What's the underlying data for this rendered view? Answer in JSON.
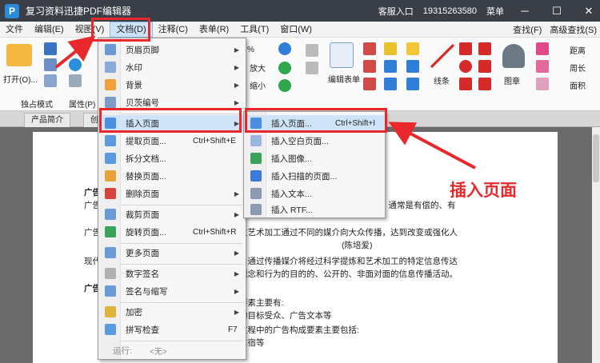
{
  "window": {
    "title": "复习资料迅捷PDF编辑器",
    "logo_glyph": "P",
    "login": "客服入口",
    "phone": "19315263580",
    "menu": "菜单"
  },
  "menubar": {
    "items": [
      "文件",
      "编辑(E)",
      "视图(V)",
      "文档(D)",
      "注释(C)",
      "表单(R)",
      "工具(T)",
      "窗口(W)"
    ],
    "active": "文档(D)",
    "find": "查找(F)",
    "advanced_find": "高级查找(S)"
  },
  "ribbon": {
    "open": "打开(O)...",
    "mode": "独占模式",
    "props": "属性(P)",
    "zoom_in": "放大",
    "zoom_out": "缩小",
    "edit_form": "编辑表单",
    "line": "线条",
    "stamp": "图章",
    "distance": "距离",
    "perimeter": "周长",
    "area": "面积",
    "zoom_value": "%"
  },
  "tabs": [
    "产品简介",
    "创"
  ],
  "doc_menu": {
    "items": [
      {
        "label": "页眉页脚",
        "shortcut": "",
        "arrow": true
      },
      {
        "label": "水印",
        "shortcut": "",
        "arrow": true
      },
      {
        "label": "背景",
        "shortcut": "",
        "arrow": true
      },
      {
        "label": "贝茨编号",
        "shortcut": "",
        "arrow": true
      },
      {
        "label": "插入页面",
        "shortcut": "",
        "arrow": true
      },
      {
        "label": "提取页面...",
        "shortcut": "Ctrl+Shift+E",
        "arrow": false
      },
      {
        "label": "拆分文档...",
        "shortcut": "",
        "arrow": false
      },
      {
        "label": "替换页面...",
        "shortcut": "",
        "arrow": false
      },
      {
        "label": "删除页面",
        "shortcut": "",
        "arrow": true
      },
      {
        "label": "裁剪页面",
        "shortcut": "",
        "arrow": true
      },
      {
        "label": "旋转页面...",
        "shortcut": "Ctrl+Shift+R",
        "arrow": false
      },
      {
        "label": "更多页面",
        "shortcut": "",
        "arrow": true
      },
      {
        "label": "数字签名",
        "shortcut": "",
        "arrow": true
      },
      {
        "label": "签名与缩写",
        "shortcut": "",
        "arrow": true
      },
      {
        "label": "加密",
        "shortcut": "",
        "arrow": true
      },
      {
        "label": "拼写检查",
        "shortcut": "F7",
        "arrow": false
      },
      {
        "label": "运行:",
        "shortcut": "<无>",
        "arrow": true
      }
    ]
  },
  "insert_menu": {
    "items": [
      {
        "label": "插入页面...",
        "shortcut": "Ctrl+Shift+I"
      },
      {
        "label": "插入空白页面..."
      },
      {
        "label": "插入图像..."
      },
      {
        "label": "插入扫描的页面..."
      },
      {
        "label": "插入文本..."
      },
      {
        "label": "插入 RTF..."
      }
    ]
  },
  "annotation": {
    "label": "插入页面"
  },
  "document": {
    "lines": [
      "广告",
      "广告",
      "，通常是有偿的、有",
      "广告",
      "过艺术加工通过不同的媒介向大众传播，达到改变或强化人",
      "(陈培爱)",
      "现代",
      "，通过传播媒介将经过科学提炼和艺术加工的特定信息传达",
      "观念和行为的目的的、公开的、非面对面的信息传播活动。",
      "广告",
      "要素主要有:",
      "的目标受众、广告文本等",
      "过程中的广告构成要素主要包括:",
      "信宿等"
    ]
  },
  "colors": {
    "accent": "#e8282b",
    "titlebar": "#3a3f47",
    "highlight": "#cfe4f8"
  }
}
